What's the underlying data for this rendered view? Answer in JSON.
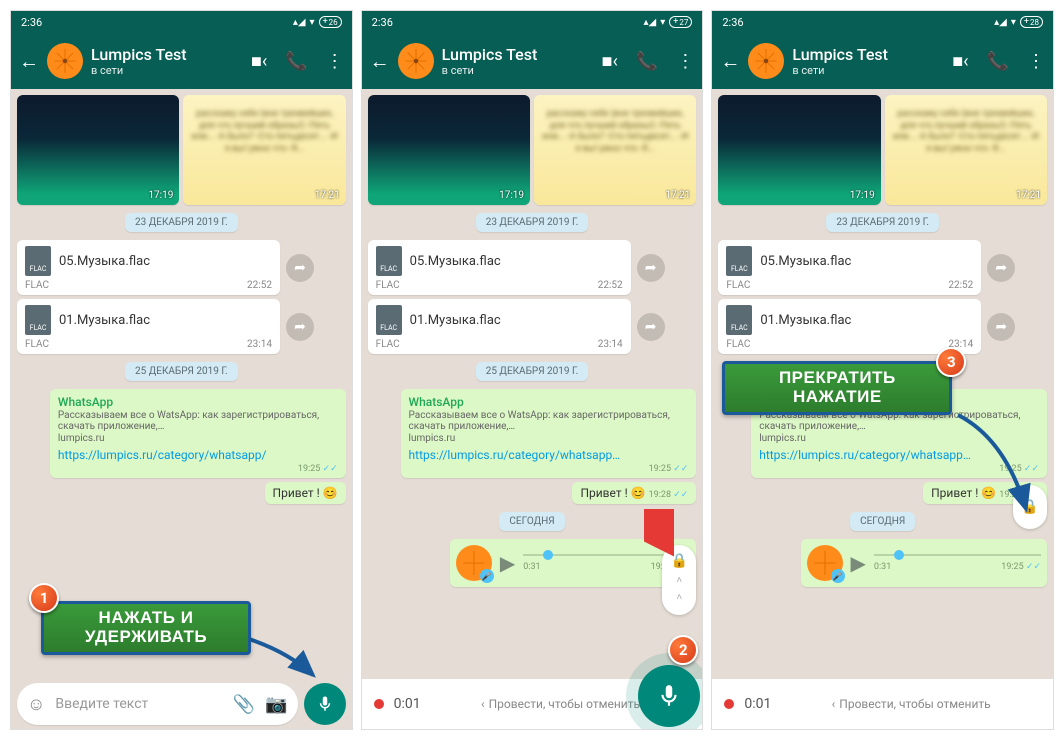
{
  "status": {
    "time": "2:36",
    "batteries": [
      "26",
      "27",
      "28"
    ]
  },
  "header": {
    "name": "Lumpics Test",
    "status": "в сети"
  },
  "dates": {
    "d1": "23 ДЕКАБРЯ 2019 Г.",
    "d2": "25 ДЕКАБРЯ 2019 Г.",
    "today": "СЕГОДНЯ"
  },
  "img_times": {
    "a": "17:19",
    "b": "17:21"
  },
  "files": [
    {
      "name": "05.Музыка.flac",
      "ext": "FLAC",
      "time": "22:52"
    },
    {
      "name": "01.Музыка.flac",
      "ext": "FLAC",
      "time": "23:14"
    }
  ],
  "link_msg": {
    "title": "WhatsApp",
    "desc": "Рассказываем все о WatsApp: как зарегистрироваться, скачать приложение,…",
    "domain": "lumpics.ru",
    "url_full": "https://lumpics.ru/category/whatsapp/",
    "url_trunc": "https://lumpics.ru/category/whatsapp…",
    "time": "19:25"
  },
  "hello": {
    "text": "Привет ! 😊",
    "text_partial": "Привет ! 😊",
    "time": "19:28"
  },
  "voice": {
    "dur": "0:31",
    "time": "19:25"
  },
  "input": {
    "placeholder": "Введите текст"
  },
  "recording": {
    "time": "0:01",
    "cancel": "Провести, чтобы отменить"
  },
  "callouts": {
    "c1": "НАЖАТЬ И УДЕРЖИВАТЬ",
    "c3": "ПРЕКРАТИТЬ НАЖАТИЕ"
  },
  "badges": {
    "n1": "1",
    "n2": "2",
    "n3": "3"
  },
  "blur_text": "расскажу себе (вне трезвейших, для что лучший образы!) -Пять или... -А было? -Сто пятьдесят... -И я вы! ужно что -Я..."
}
